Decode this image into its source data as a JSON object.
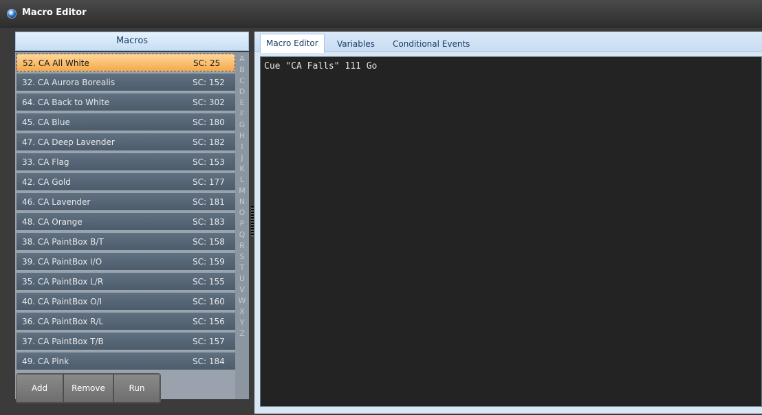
{
  "window": {
    "title": "Macro Editor"
  },
  "macros_panel": {
    "header": "Macros",
    "items": [
      {
        "name": "52. CA All White",
        "sc": "SC: 25",
        "selected": true
      },
      {
        "name": "32. CA Aurora Borealis",
        "sc": "SC: 152"
      },
      {
        "name": "64. CA Back to White",
        "sc": "SC: 302"
      },
      {
        "name": "45. CA Blue",
        "sc": "SC: 180"
      },
      {
        "name": "47. CA Deep Lavender",
        "sc": "SC: 182"
      },
      {
        "name": "33. CA Flag",
        "sc": "SC: 153"
      },
      {
        "name": "42. CA Gold",
        "sc": "SC: 177"
      },
      {
        "name": "46. CA Lavender",
        "sc": "SC: 181"
      },
      {
        "name": "48. CA Orange",
        "sc": "SC: 183"
      },
      {
        "name": "38. CA PaintBox B/T",
        "sc": "SC: 158"
      },
      {
        "name": "39. CA PaintBox I/O",
        "sc": "SC: 159"
      },
      {
        "name": "35. CA PaintBox L/R",
        "sc": "SC: 155"
      },
      {
        "name": "40. CA PaintBox O/I",
        "sc": "SC: 160"
      },
      {
        "name": "36. CA PaintBox R/L",
        "sc": "SC: 156"
      },
      {
        "name": "37. CA PaintBox T/B",
        "sc": "SC: 157"
      },
      {
        "name": "49. CA Pink",
        "sc": "SC: 184"
      }
    ],
    "alphabet": [
      "A",
      "B",
      "C",
      "D",
      "E",
      "F",
      "G",
      "H",
      "I",
      "J",
      "K",
      "L",
      "M",
      "N",
      "O",
      "P",
      "Q",
      "R",
      "S",
      "T",
      "U",
      "V",
      "W",
      "X",
      "Y",
      "Z"
    ],
    "buttons": {
      "add": "Add",
      "remove": "Remove",
      "run": "Run"
    }
  },
  "tabs": [
    {
      "label": "Macro Editor",
      "active": true
    },
    {
      "label": "Variables"
    },
    {
      "label": "Conditional Events"
    }
  ],
  "editor": {
    "content": "Cue \"CA Falls\" 111 Go"
  },
  "colors": {
    "selected_item": "#f5a94b",
    "tab_accent": "#c8dcf2",
    "editor_bg": "#232323"
  },
  "icons": {
    "title": "app-globe-icon"
  }
}
